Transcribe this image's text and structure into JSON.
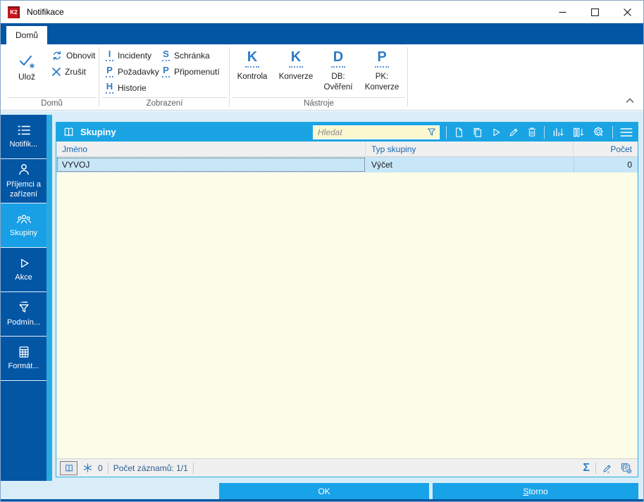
{
  "window": {
    "title": "Notifikace",
    "icon_text": "K2"
  },
  "ribbon": {
    "active_tab": "Domů",
    "home": {
      "save": "Ulož",
      "refresh": "Obnovit",
      "cancel": "Zrušit"
    },
    "view_items": [
      {
        "accel": "I",
        "label": "Incidenty"
      },
      {
        "accel": "P",
        "label": "Požadavky"
      },
      {
        "accel": "H",
        "label": "Historie"
      },
      {
        "accel": "S",
        "label": "Schránka"
      },
      {
        "accel": "P",
        "label": "Připomenutí"
      }
    ],
    "tools": [
      {
        "accel": "K",
        "label": "Kontrola"
      },
      {
        "accel": "K",
        "label": "Konverze"
      },
      {
        "accel": "D",
        "label": "DB: Ověření"
      },
      {
        "accel": "P",
        "label": "PK: Konverze"
      }
    ],
    "group_labels": {
      "home": "Domů",
      "view": "Zobrazení",
      "tools": "Nástroje"
    }
  },
  "sidebar": {
    "items": [
      {
        "label": "Notifik...",
        "icon": "list-icon",
        "selected": false
      },
      {
        "label": "Příjemci a zařízení",
        "icon": "person-icon",
        "selected": false
      },
      {
        "label": "Skupiny",
        "icon": "people-icon",
        "selected": true
      },
      {
        "label": "Akce",
        "icon": "play-icon",
        "selected": false
      },
      {
        "label": "Podmín...",
        "icon": "filter-icon",
        "selected": false
      },
      {
        "label": "Formát...",
        "icon": "table-icon",
        "selected": false
      }
    ]
  },
  "grid": {
    "title": "Skupiny",
    "search_placeholder": "Hledat",
    "columns": {
      "name": "Jméno",
      "type": "Typ skupiny",
      "count": "Počet"
    },
    "rows": [
      {
        "name": "VYVOJ",
        "type": "Výčet",
        "count": "0"
      }
    ],
    "status": {
      "locks": "0",
      "records": "Počet záznamů: 1/1"
    }
  },
  "footer": {
    "ok": "OK",
    "storno_accel": "S",
    "storno_rest": "torno"
  },
  "icons": {
    "sigma": "Σ"
  },
  "colors": {
    "dark_blue": "#0356a4",
    "cyan": "#1ba4e4",
    "pale_blue": "#d9edf9",
    "grid_yellow": "#fdfce9",
    "selection_blue": "#c7e6f8",
    "header_text_blue": "#1566b0",
    "icon_blue": "#2e7cc4",
    "search_yellow": "#fbf8d0"
  }
}
